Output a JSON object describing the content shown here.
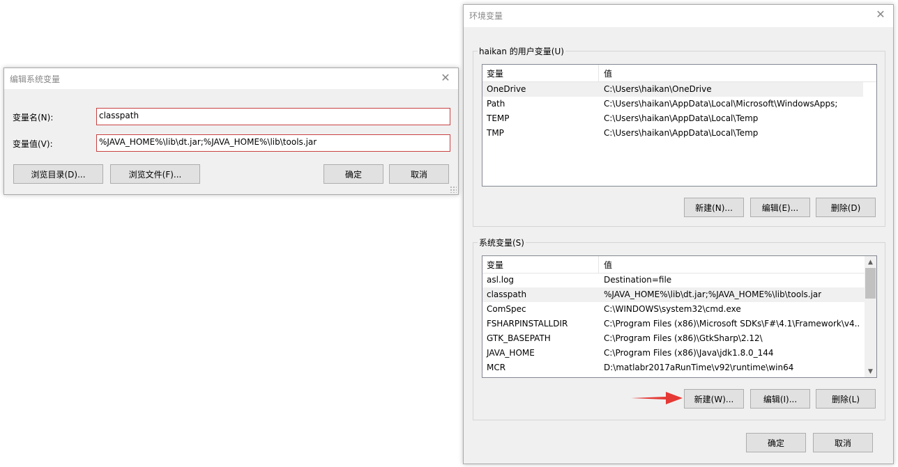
{
  "edit_dialog": {
    "title": "编辑系统变量",
    "name_label": "变量名(N):",
    "value_label": "变量值(V):",
    "name_value": "classpath",
    "value_value": "%JAVA_HOME%\\lib\\dt.jar;%JAVA_HOME%\\lib\\tools.jar",
    "browse_dir_button": "浏览目录(D)...",
    "browse_file_button": "浏览文件(F)...",
    "ok_button": "确定",
    "cancel_button": "取消"
  },
  "env_dialog": {
    "title": "环境变量",
    "user_group_title": "haikan 的用户变量(U)",
    "system_group_title": "系统变量(S)",
    "col_variable": "变量",
    "col_value": "值",
    "user_vars": [
      {
        "name": "OneDrive",
        "value": "C:\\Users\\haikan\\OneDrive"
      },
      {
        "name": "Path",
        "value": "C:\\Users\\haikan\\AppData\\Local\\Microsoft\\WindowsApps;"
      },
      {
        "name": "TEMP",
        "value": "C:\\Users\\haikan\\AppData\\Local\\Temp"
      },
      {
        "name": "TMP",
        "value": "C:\\Users\\haikan\\AppData\\Local\\Temp"
      }
    ],
    "system_vars": [
      {
        "name": "asl.log",
        "value": "Destination=file"
      },
      {
        "name": "classpath",
        "value": "%JAVA_HOME%\\lib\\dt.jar;%JAVA_HOME%\\lib\\tools.jar"
      },
      {
        "name": "ComSpec",
        "value": "C:\\WINDOWS\\system32\\cmd.exe"
      },
      {
        "name": "FSHARPINSTALLDIR",
        "value": "C:\\Program Files (x86)\\Microsoft SDKs\\F#\\4.1\\Framework\\v4...."
      },
      {
        "name": "GTK_BASEPATH",
        "value": "C:\\Program Files (x86)\\GtkSharp\\2.12\\"
      },
      {
        "name": "JAVA_HOME",
        "value": "C:\\Program Files (x86)\\Java\\jdk1.8.0_144"
      },
      {
        "name": "MCR",
        "value": "D:\\matlabr2017aRunTime\\v92\\runtime\\win64"
      }
    ],
    "user_new": "新建(N)...",
    "user_edit": "编辑(E)...",
    "user_delete": "删除(D)",
    "sys_new": "新建(W)...",
    "sys_edit": "编辑(I)...",
    "sys_delete": "删除(L)",
    "ok_button": "确定",
    "cancel_button": "取消"
  },
  "icons": {
    "close": "close-icon",
    "arrow": "arrow-icon"
  },
  "colors": {
    "input_border": "#c94040",
    "arrow": "#e53935",
    "dialog_bg": "#f0f0f0"
  }
}
